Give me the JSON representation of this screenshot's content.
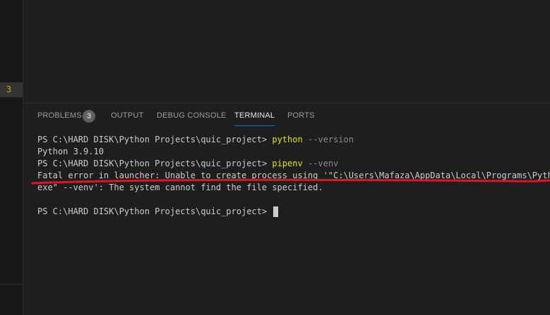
{
  "rail": {
    "badge_count": "3"
  },
  "panel": {
    "tabs": [
      {
        "label": "PROBLEMS"
      },
      {
        "label": "OUTPUT"
      },
      {
        "label": "DEBUG CONSOLE"
      },
      {
        "label": "TERMINAL"
      },
      {
        "label": "PORTS"
      }
    ],
    "problems_count": "3",
    "active_tab": "TERMINAL"
  },
  "terminal": {
    "line1_prompt": "PS C:\\HARD DISK\\Python Projects\\quic_project> ",
    "line1_cmd": "python",
    "line1_arg": " --version",
    "line2": "Python 3.9.10",
    "line3_prompt": "PS C:\\HARD DISK\\Python Projects\\quic_project> ",
    "line3_cmd": "pipenv",
    "line3_arg": " --venv",
    "line4": "Fatal error in launcher: Unable to create process using '\"C:\\Users\\Mafaza\\AppData\\Local\\Programs\\Python\\",
    "line5": "exe\" --venv': The system cannot find the file specified.",
    "line6": "",
    "line7_prompt": "PS C:\\HARD DISK\\Python Projects\\quic_project> "
  },
  "colors": {
    "command": "#e5e510",
    "argument": "#8a8a8a",
    "annotation_underline": "#e81123",
    "active_tab_indicator": "#0078d4"
  }
}
